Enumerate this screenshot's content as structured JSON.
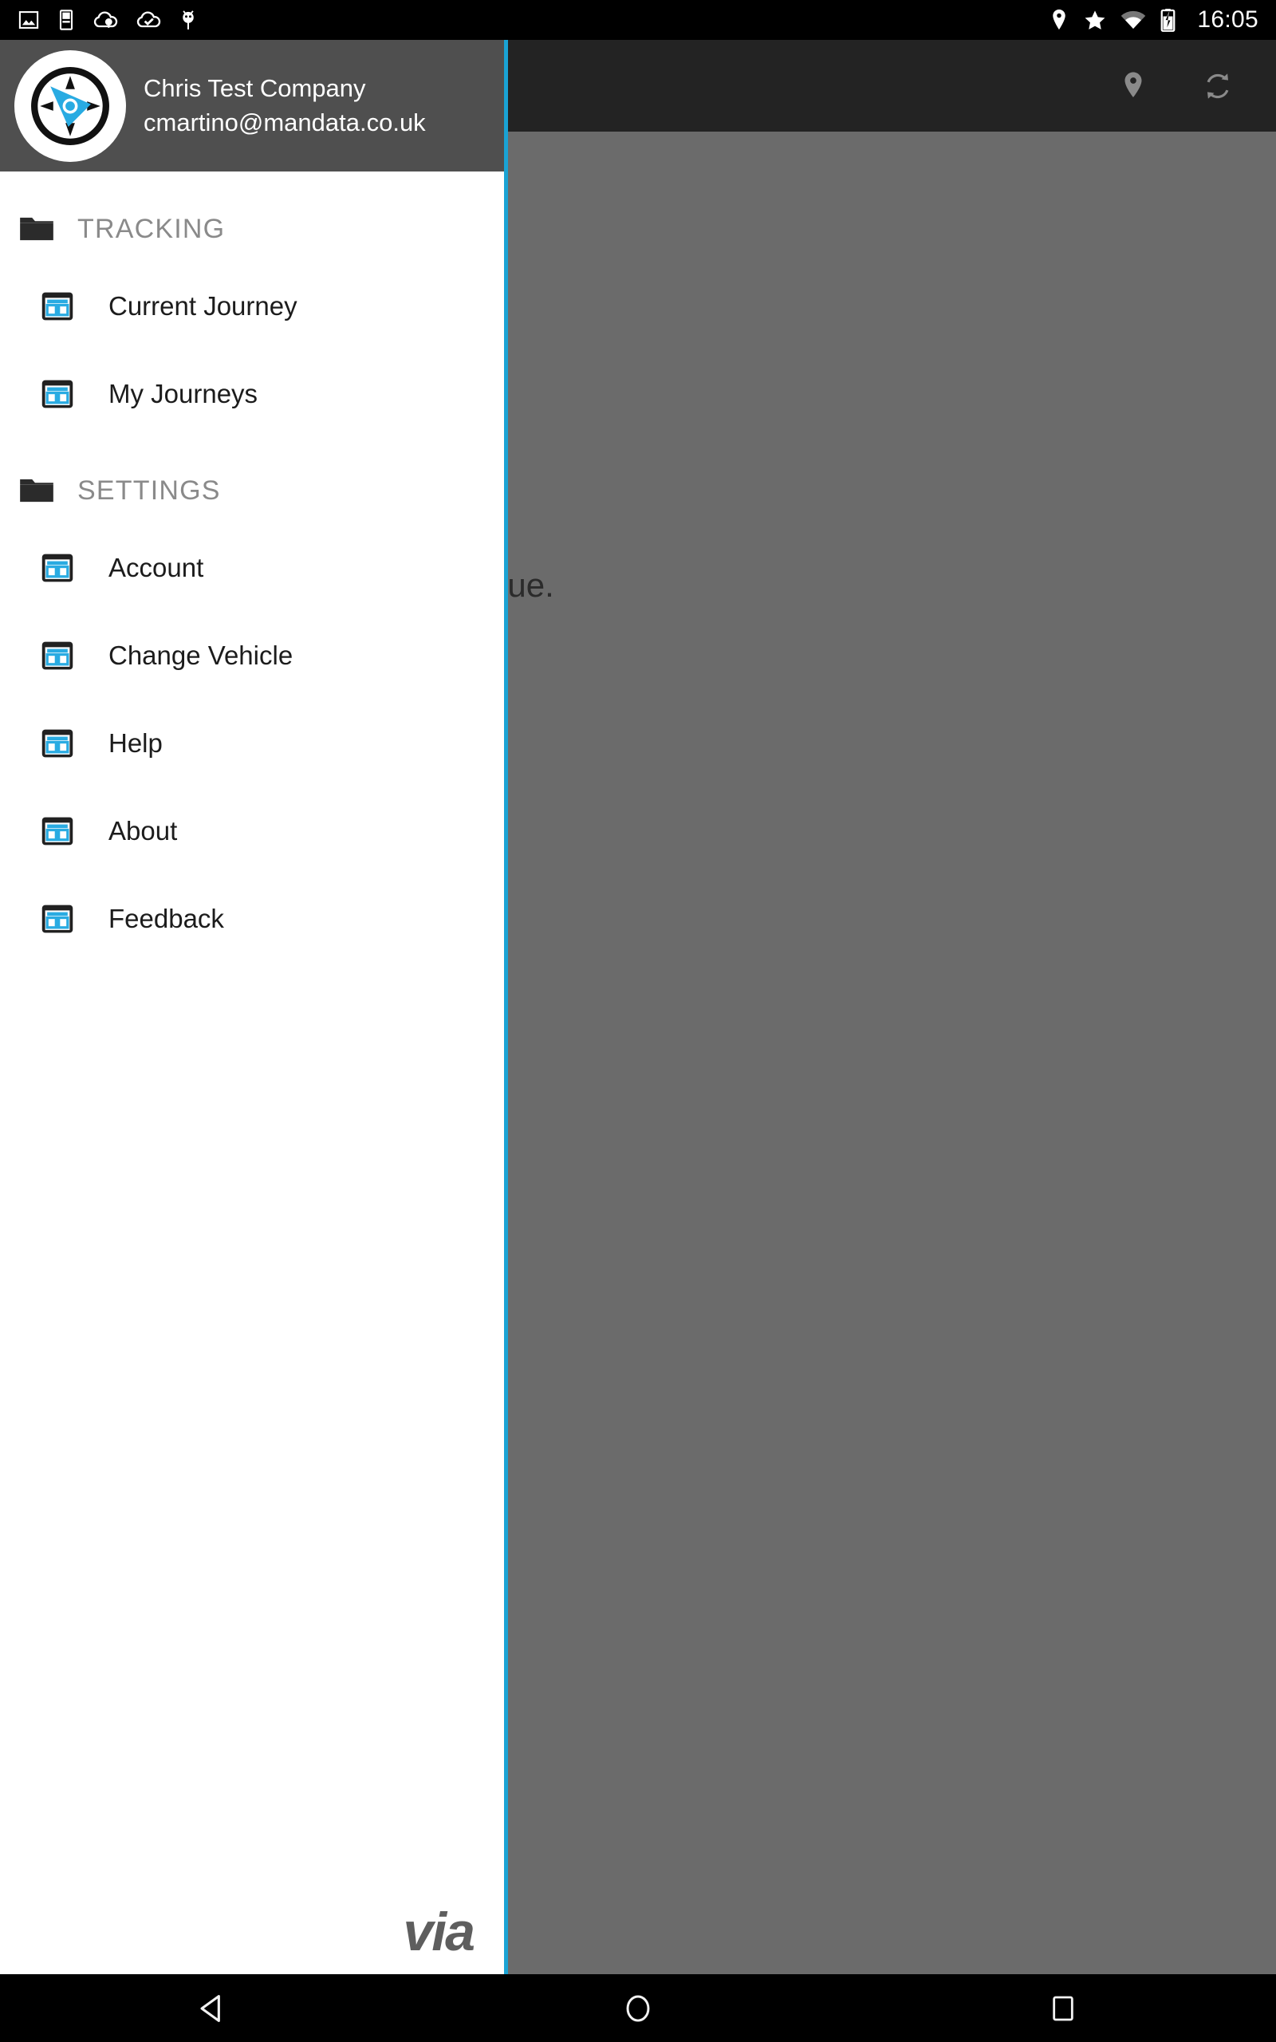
{
  "status_bar": {
    "time": "16:05",
    "left_icons": [
      {
        "name": "image-icon"
      },
      {
        "name": "storage-icon"
      },
      {
        "name": "cloud-sync-icon"
      },
      {
        "name": "cloud-done-icon"
      },
      {
        "name": "android-debug-icon"
      }
    ],
    "right_icons": [
      {
        "name": "location-icon"
      },
      {
        "name": "star-icon"
      },
      {
        "name": "wifi-icon"
      },
      {
        "name": "battery-charging-icon"
      }
    ]
  },
  "app_bar": {
    "background_color": "#232323",
    "actions": [
      {
        "name": "location-pin-action",
        "icon": "location-pin-icon"
      },
      {
        "name": "refresh-action",
        "icon": "refresh-icon"
      }
    ]
  },
  "content": {
    "message": "off to continue.",
    "scrim_color": "#6b6b6b"
  },
  "drawer": {
    "accent_color": "#1aa3d4",
    "header_background": "#4f4f4f",
    "logo_icon": "compass-icon",
    "account_name": "Chris Test Company",
    "account_email": "cmartino@mandata.co.uk",
    "footer_logo": "via",
    "sections": [
      {
        "label": "TRACKING",
        "icon": "folder-icon",
        "items": [
          {
            "label": "Current Journey",
            "icon": "dashboard-icon"
          },
          {
            "label": "My Journeys",
            "icon": "dashboard-icon"
          }
        ]
      },
      {
        "label": "SETTINGS",
        "icon": "folder-icon",
        "items": [
          {
            "label": "Account",
            "icon": "dashboard-icon"
          },
          {
            "label": "Change Vehicle",
            "icon": "dashboard-icon"
          },
          {
            "label": "Help",
            "icon": "dashboard-icon"
          },
          {
            "label": "About",
            "icon": "dashboard-icon"
          },
          {
            "label": "Feedback",
            "icon": "dashboard-icon"
          }
        ]
      }
    ]
  },
  "nav_bar": {
    "buttons": [
      {
        "name": "back-button",
        "icon": "back-triangle-icon"
      },
      {
        "name": "home-button",
        "icon": "home-circle-icon"
      },
      {
        "name": "recents-button",
        "icon": "recents-square-icon"
      }
    ]
  }
}
